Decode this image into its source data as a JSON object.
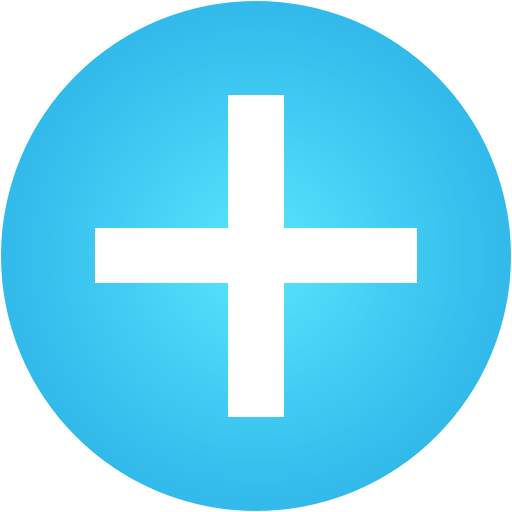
{
  "add_button": {
    "icon": "plus-icon",
    "colors": {
      "center": "#5ae6fc",
      "edge": "#28ace2",
      "glyph": "#ffffff"
    }
  }
}
